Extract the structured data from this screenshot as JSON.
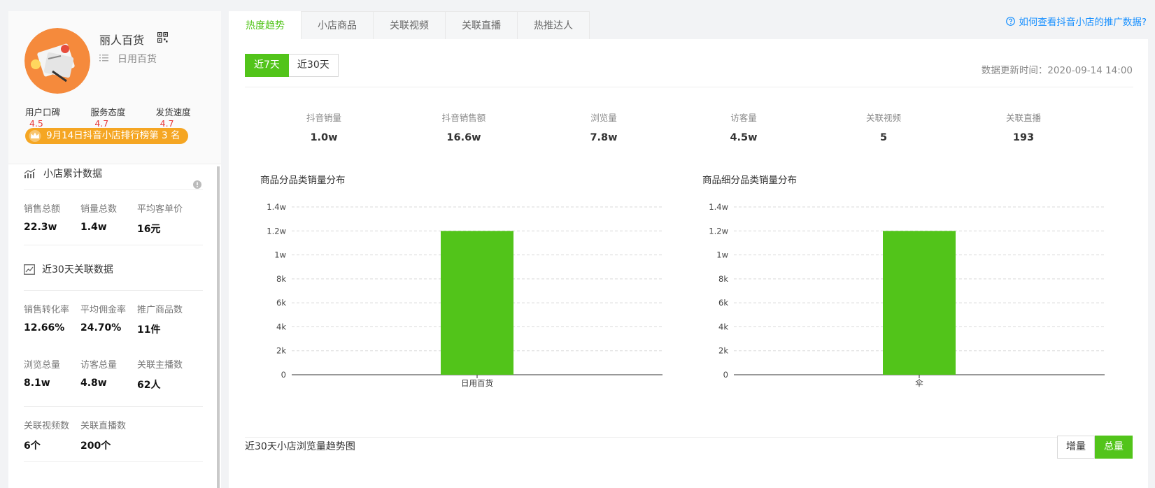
{
  "shop": {
    "name": "丽人百货",
    "category": "日用百货",
    "ratings": [
      {
        "label": "用户口碑",
        "value": "4.5"
      },
      {
        "label": "服务态度",
        "value": "4.7"
      },
      {
        "label": "发货速度",
        "value": "4.7"
      }
    ],
    "rank": "9月14日抖音小店排行榜第 3 名"
  },
  "cumulative": {
    "title": "小店累计数据",
    "stats": [
      {
        "label": "销售总额",
        "value": "22.3w"
      },
      {
        "label": "销量总数",
        "value": "1.4w"
      },
      {
        "label": "平均客单价",
        "value": "16元"
      }
    ]
  },
  "recent30": {
    "title": "近30天关联数据",
    "stats": [
      {
        "label": "销售转化率",
        "value": "12.66%"
      },
      {
        "label": "平均佣金率",
        "value": "24.70%"
      },
      {
        "label": "推广商品数",
        "value": "11件"
      },
      {
        "label": "浏览总量",
        "value": "8.1w"
      },
      {
        "label": "访客总量",
        "value": "4.8w"
      },
      {
        "label": "关联主播数",
        "value": "62人"
      },
      {
        "label": "关联视频数",
        "value": "6个"
      },
      {
        "label": "关联直播数",
        "value": "200个"
      }
    ]
  },
  "tabs": [
    "热度趋势",
    "小店商品",
    "关联视频",
    "关联直播",
    "热推达人"
  ],
  "help_link": "如何查看抖音小店的推广数据?",
  "range": {
    "options": [
      "近7天",
      "近30天"
    ],
    "selected": "近7天"
  },
  "update_time": "数据更新时间：2020-09-14 14:00",
  "metrics": [
    {
      "label": "抖音销量",
      "value": "1.0w"
    },
    {
      "label": "抖音销售额",
      "value": "16.6w"
    },
    {
      "label": "浏览量",
      "value": "7.8w"
    },
    {
      "label": "访客量",
      "value": "4.5w"
    },
    {
      "label": "关联视频",
      "value": "5"
    },
    {
      "label": "关联直播",
      "value": "193"
    }
  ],
  "chart_data": [
    {
      "type": "bar",
      "title": "商品分品类销量分布",
      "categories": [
        "日用百货"
      ],
      "values": [
        12000
      ],
      "ylim": [
        0,
        14000
      ],
      "yticks": [
        "0",
        "2k",
        "4k",
        "6k",
        "8k",
        "1w",
        "1.2w",
        "1.4w"
      ],
      "color": "#52c41a",
      "grid": true
    },
    {
      "type": "bar",
      "title": "商品细分品类销量分布",
      "categories": [
        "伞"
      ],
      "values": [
        12000
      ],
      "ylim": [
        0,
        14000
      ],
      "yticks": [
        "0",
        "2k",
        "4k",
        "6k",
        "8k",
        "1w",
        "1.2w",
        "1.4w"
      ],
      "color": "#52c41a",
      "grid": true
    }
  ],
  "trend": {
    "title": "近30天小店浏览量趋势图",
    "toggle": [
      "增量",
      "总量"
    ],
    "selected": "总量"
  },
  "colors": {
    "accent": "#52c41a",
    "rating": "#e83b3b",
    "badge": "#f5a623",
    "link": "#1890ff"
  }
}
